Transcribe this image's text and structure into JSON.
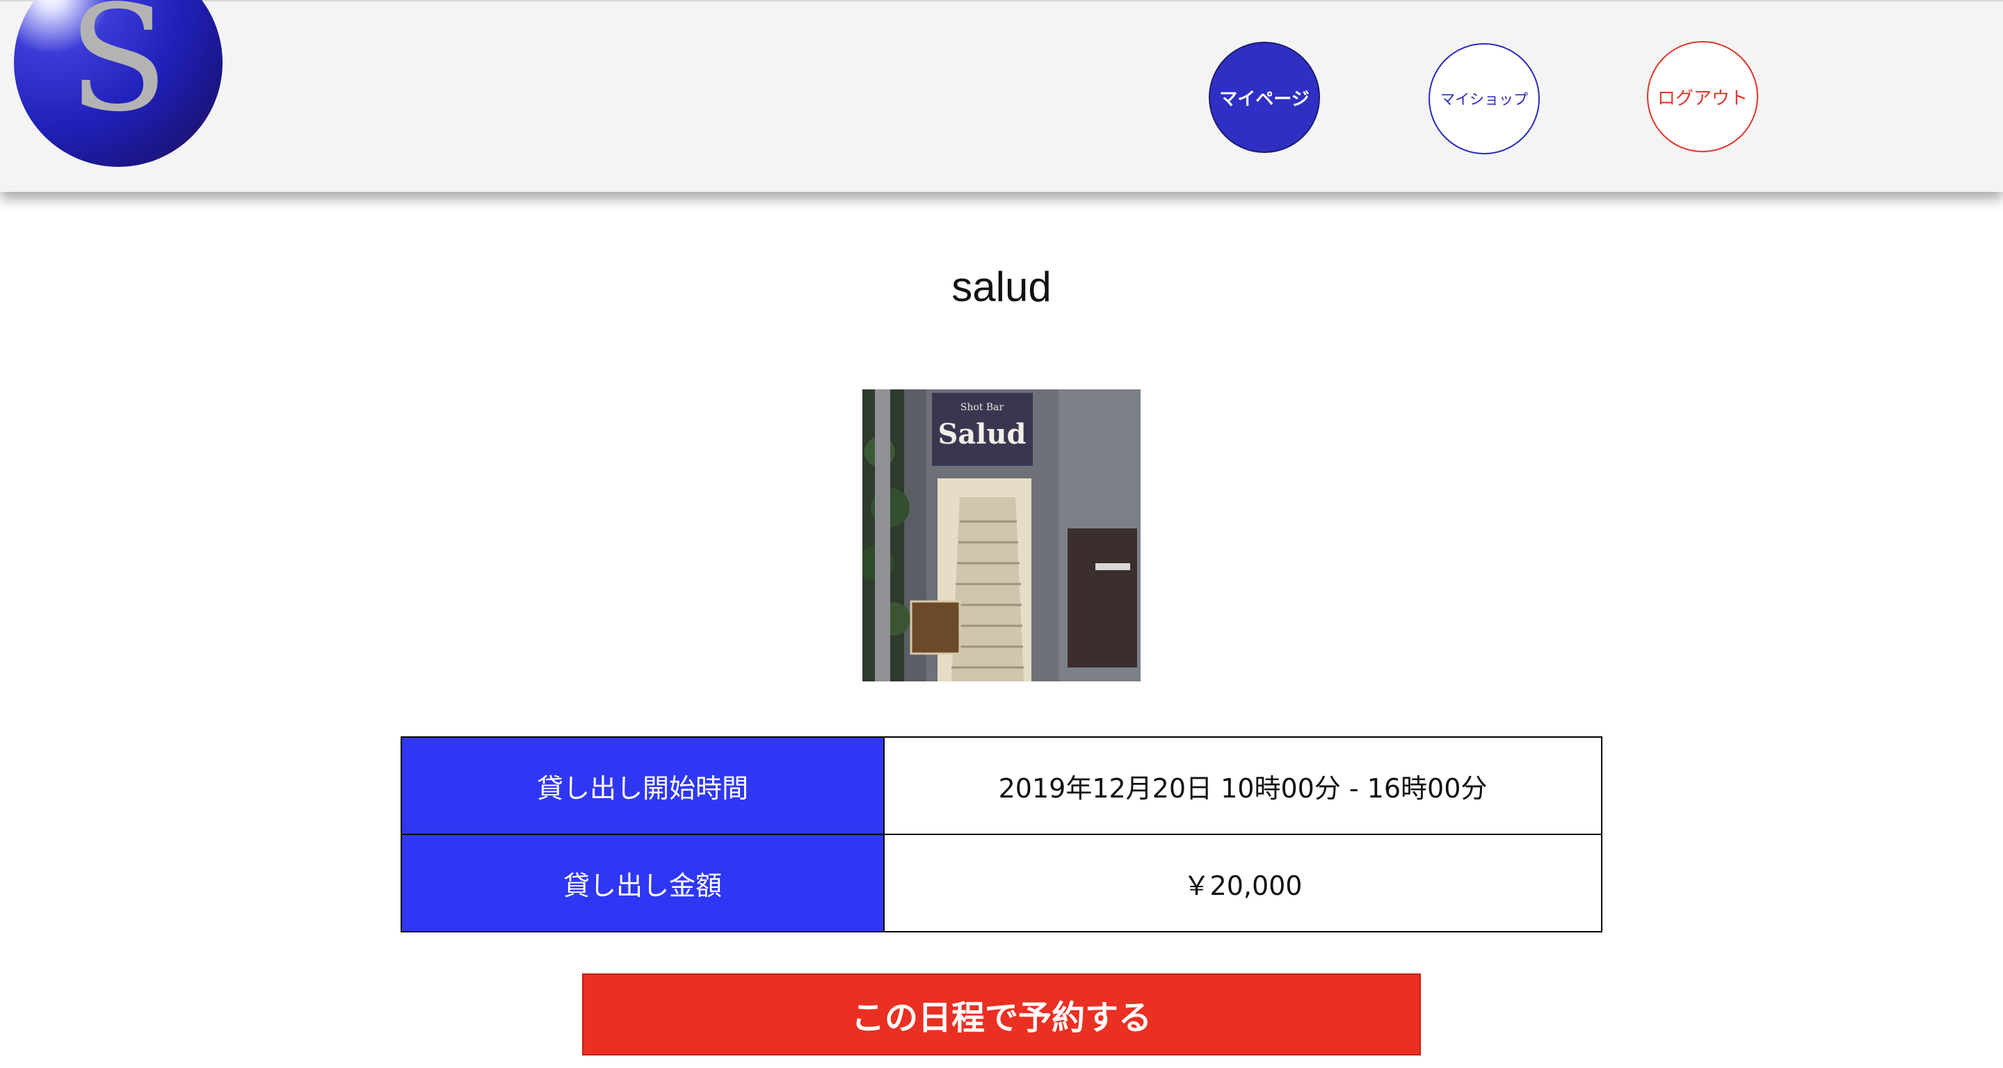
{
  "header": {
    "logo_letter": "S",
    "nav": {
      "mypage_label": "マイページ",
      "myshop_label": "マイショップ",
      "logout_label": "ログアウト"
    }
  },
  "shop": {
    "name": "salud",
    "photo_sign_small": "Shot Bar",
    "photo_sign_name": "Salud"
  },
  "details": {
    "rows": [
      {
        "label": "貸し出し開始時間",
        "value": "2019年12月20日 10時00分 - 16時00分"
      },
      {
        "label": "貸し出し金額",
        "value": "￥20,000"
      }
    ]
  },
  "reserve_button_label": "この日程で予約する",
  "colors": {
    "accent_blue": "#2f37f5",
    "nav_blue": "#2f2fc4",
    "accent_red": "#ea3023"
  }
}
